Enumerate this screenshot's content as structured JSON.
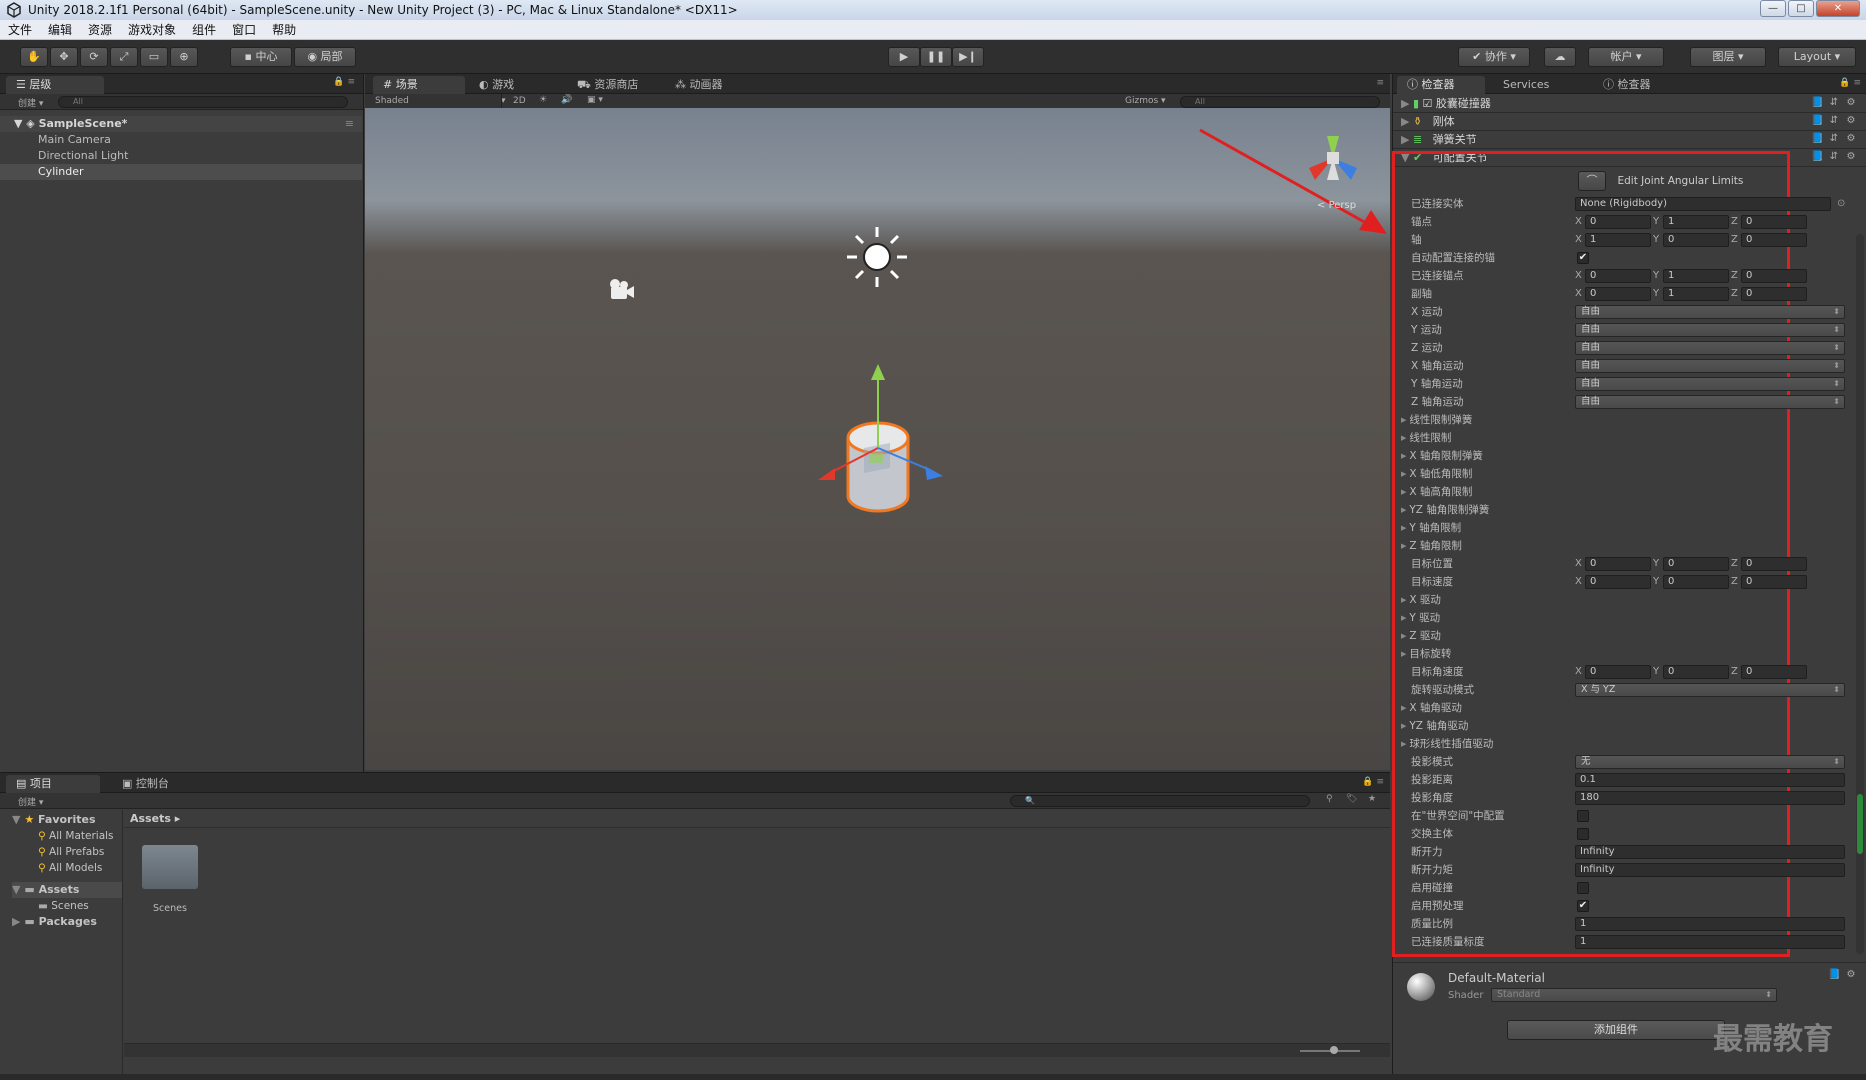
{
  "window": {
    "title": "Unity 2018.2.1f1 Personal (64bit) - SampleScene.unity - New Unity Project (3) - PC, Mac & Linux Standalone* <DX11>",
    "min": "—",
    "max": "□",
    "close": "✕"
  },
  "menu": [
    "文件",
    "编辑",
    "资源",
    "游戏对象",
    "组件",
    "窗口",
    "帮助"
  ],
  "toolbar": {
    "pivot": "中心",
    "space": "局部",
    "collab": "协作",
    "account": "帐户",
    "layers": "图层",
    "layout": "Layout"
  },
  "hierarchy": {
    "tab": "层级",
    "create": "创建",
    "search_placeholder": "All",
    "scene": "SampleScene*",
    "items": [
      "Main Camera",
      "Directional Light",
      "Cylinder"
    ]
  },
  "scene": {
    "tabs": [
      "场景",
      "游戏",
      "资源商店",
      "动画器"
    ],
    "shading": "Shaded",
    "mode2d": "2D",
    "gizmos": "Gizmos",
    "search_placeholder": "All",
    "persp": "Persp"
  },
  "inspector": {
    "tabs": [
      "检查器",
      "Services",
      "检查器"
    ],
    "components": [
      "胶囊碰撞器",
      "刚体",
      "弹簧关节",
      "可配置关节"
    ],
    "edit_limits": "Edit Joint Angular Limits",
    "rows": [
      {
        "label": "已连接实体",
        "type": "object",
        "value": "None (Rigidbody)"
      },
      {
        "label": "锚点",
        "type": "xyz",
        "x": "0",
        "y": "1",
        "z": "0"
      },
      {
        "label": "轴",
        "type": "xyz",
        "x": "1",
        "y": "0",
        "z": "0"
      },
      {
        "label": "自动配置连接的锚",
        "type": "check",
        "checked": "✔"
      },
      {
        "label": "已连接锚点",
        "type": "xyz",
        "x": "0",
        "y": "1",
        "z": "0"
      },
      {
        "label": "副轴",
        "type": "xyz",
        "x": "0",
        "y": "1",
        "z": "0"
      },
      {
        "label": "X 运动",
        "type": "drop",
        "value": "自由"
      },
      {
        "label": "Y 运动",
        "type": "drop",
        "value": "自由"
      },
      {
        "label": "Z 运动",
        "type": "drop",
        "value": "自由"
      },
      {
        "label": "X 轴角运动",
        "type": "drop",
        "value": "自由"
      },
      {
        "label": "Y 轴角运动",
        "type": "drop",
        "value": "自由"
      },
      {
        "label": "Z 轴角运动",
        "type": "drop",
        "value": "自由"
      },
      {
        "label": "线性限制弹簧",
        "type": "fold"
      },
      {
        "label": "线性限制",
        "type": "fold"
      },
      {
        "label": "X 轴角限制弹簧",
        "type": "fold"
      },
      {
        "label": "X 轴低角限制",
        "type": "fold"
      },
      {
        "label": "X 轴高角限制",
        "type": "fold"
      },
      {
        "label": "YZ 轴角限制弹簧",
        "type": "fold"
      },
      {
        "label": "Y 轴角限制",
        "type": "fold"
      },
      {
        "label": "Z 轴角限制",
        "type": "fold"
      },
      {
        "label": "目标位置",
        "type": "xyz",
        "x": "0",
        "y": "0",
        "z": "0"
      },
      {
        "label": "目标速度",
        "type": "xyz",
        "x": "0",
        "y": "0",
        "z": "0"
      },
      {
        "label": "X 驱动",
        "type": "fold"
      },
      {
        "label": "Y 驱动",
        "type": "fold"
      },
      {
        "label": "Z 驱动",
        "type": "fold"
      },
      {
        "label": "目标旋转",
        "type": "fold"
      },
      {
        "label": "目标角速度",
        "type": "xyz",
        "x": "0",
        "y": "0",
        "z": "0"
      },
      {
        "label": "旋转驱动模式",
        "type": "drop",
        "value": "X 与 YZ"
      },
      {
        "label": "X 轴角驱动",
        "type": "fold"
      },
      {
        "label": "YZ 轴角驱动",
        "type": "fold"
      },
      {
        "label": "球形线性插值驱动",
        "type": "fold"
      },
      {
        "label": "投影模式",
        "type": "drop",
        "value": "无"
      },
      {
        "label": "投影距离",
        "type": "text",
        "value": "0.1"
      },
      {
        "label": "投影角度",
        "type": "text",
        "value": "180"
      },
      {
        "label": "在\"世界空间\"中配置",
        "type": "check",
        "checked": ""
      },
      {
        "label": "交换主体",
        "type": "check",
        "checked": ""
      },
      {
        "label": "断开力",
        "type": "text",
        "value": "Infinity"
      },
      {
        "label": "断开力矩",
        "type": "text",
        "value": "Infinity"
      },
      {
        "label": "启用碰撞",
        "type": "check",
        "checked": ""
      },
      {
        "label": "启用预处理",
        "type": "check",
        "checked": "✔"
      },
      {
        "label": "质量比例",
        "type": "text",
        "value": "1"
      },
      {
        "label": "已连接质量标度",
        "type": "text",
        "value": "1"
      }
    ],
    "material": {
      "name": "Default-Material",
      "shader_label": "Shader",
      "shader": "Standard"
    },
    "add_component": "添加组件",
    "watermark": "最需教育"
  },
  "project": {
    "tabs": [
      "项目",
      "控制台"
    ],
    "create": "创建",
    "favorites": "Favorites",
    "fav_items": [
      "All Materials",
      "All Prefabs",
      "All Models"
    ],
    "assets": "Assets",
    "asset_children": [
      "Scenes"
    ],
    "packages": "Packages",
    "breadcrumb": "Assets",
    "folder": "Scenes"
  },
  "colors": {
    "highlight": "#e02020",
    "selection": "#3e5f96"
  }
}
